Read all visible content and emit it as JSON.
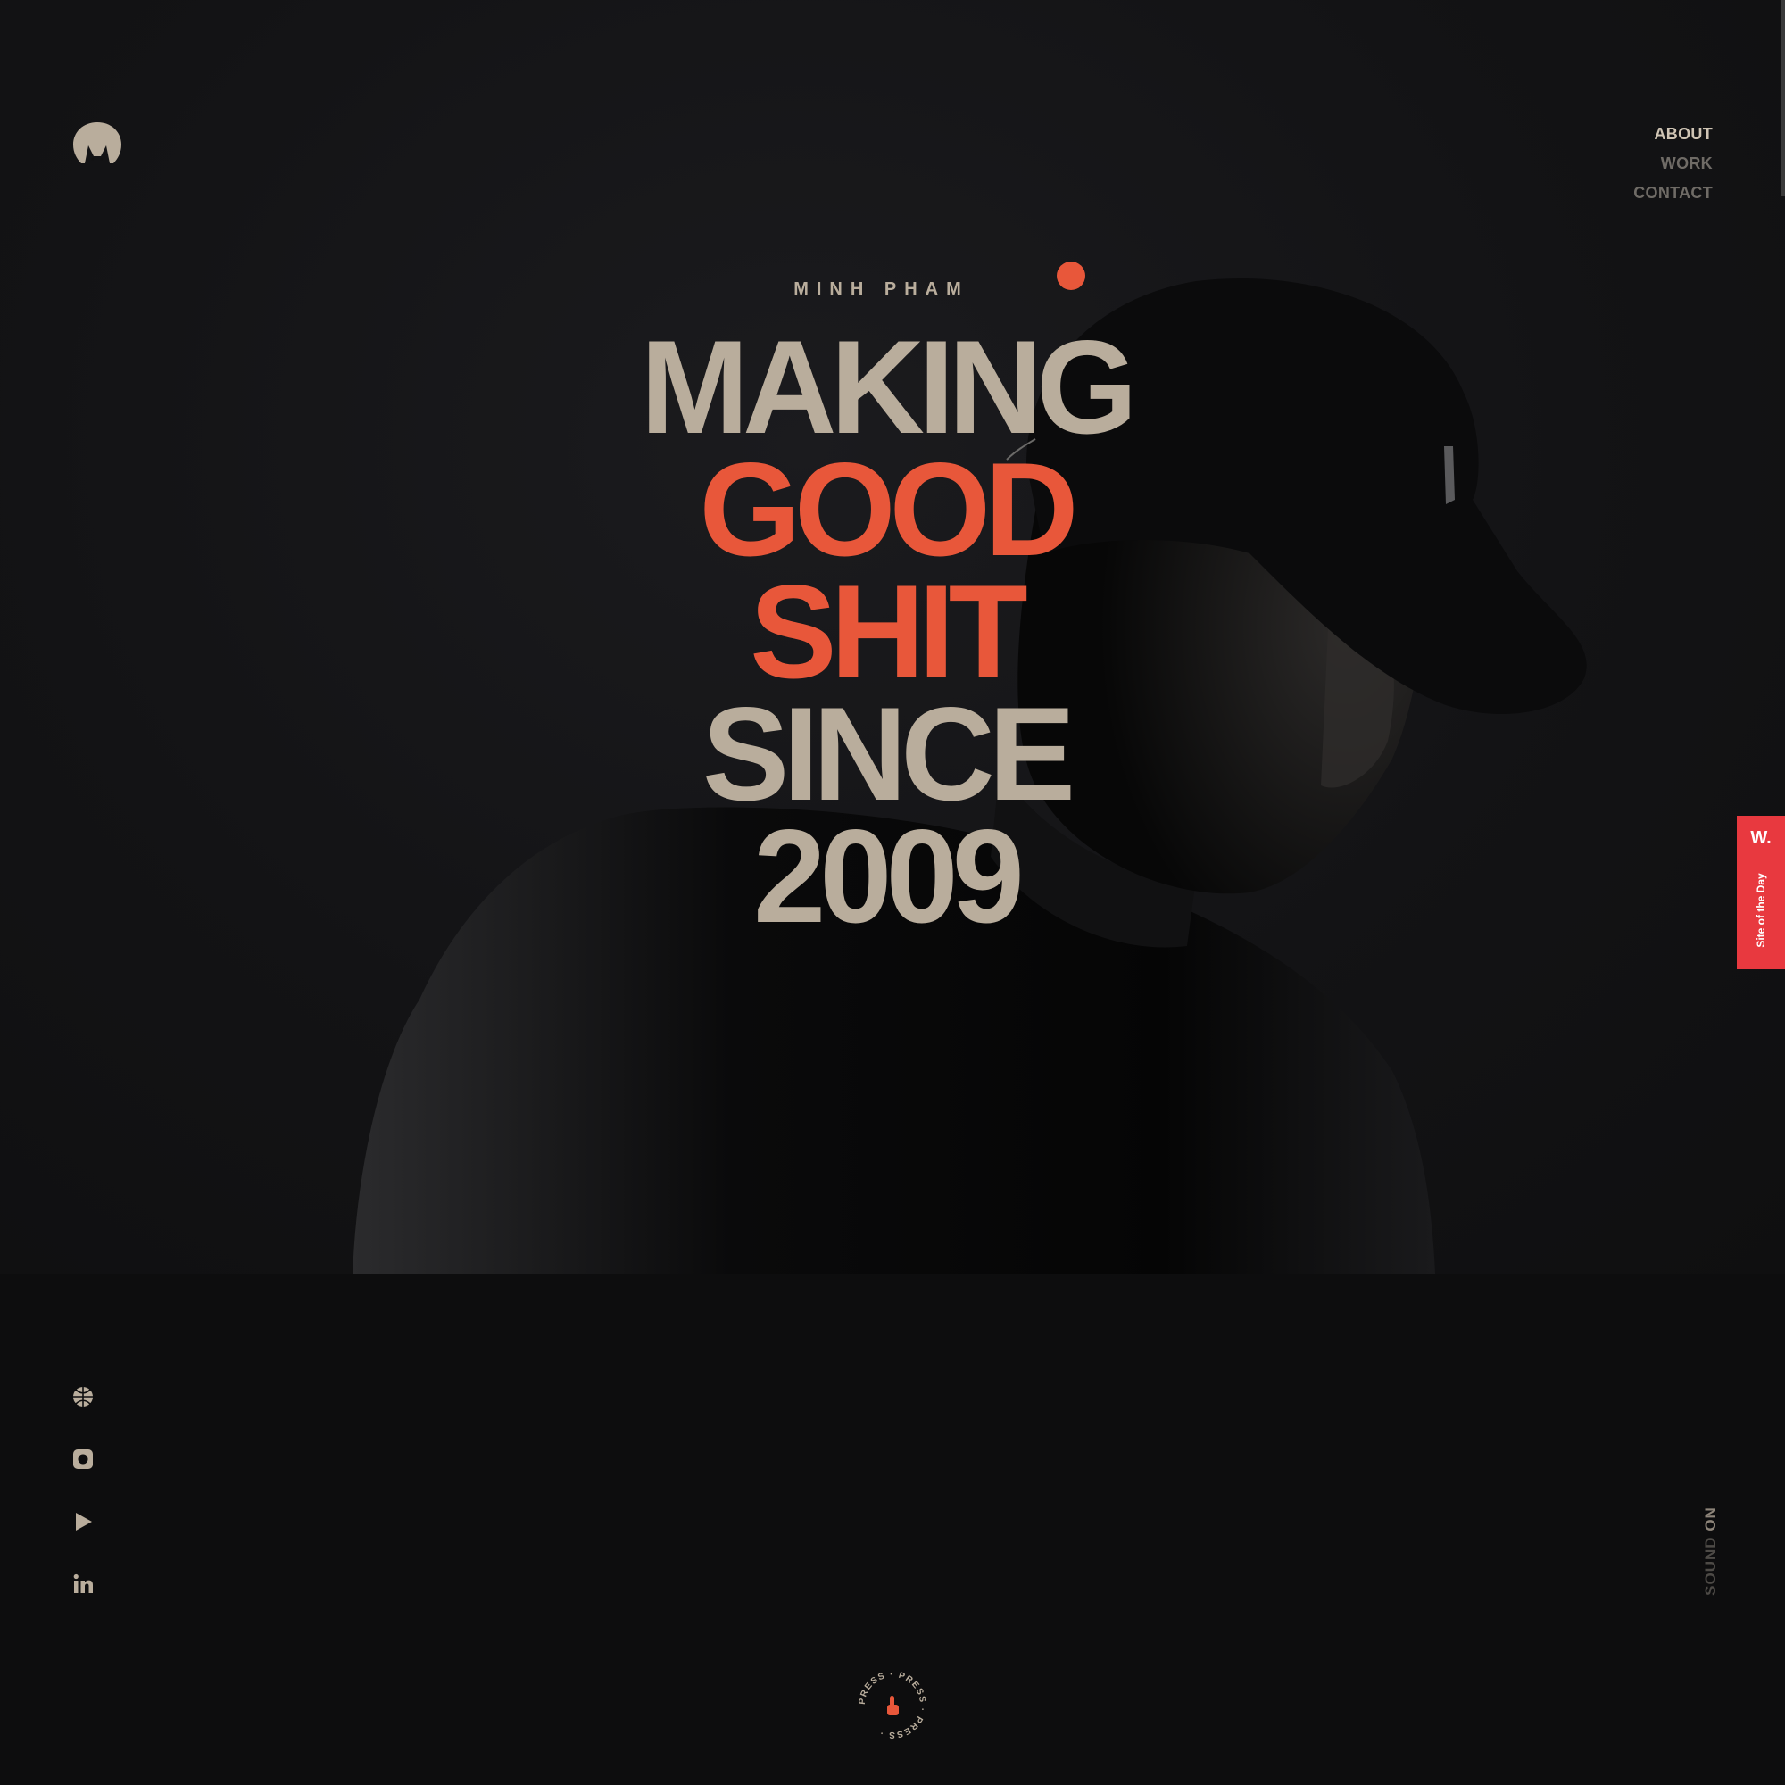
{
  "nav": {
    "items": [
      {
        "label": "ABOUT",
        "active": true
      },
      {
        "label": "WORK",
        "active": false
      },
      {
        "label": "CONTACT",
        "active": false
      }
    ]
  },
  "hero": {
    "eyebrow": "MINH PHAM",
    "lines": [
      "MAKING",
      "GOOD",
      "SHIT",
      "SINCE",
      "2009"
    ],
    "accent_lines": [
      1,
      2
    ]
  },
  "badge": {
    "mark": "W.",
    "label": "Site of the Day"
  },
  "social": {
    "icons": [
      "dribbble-icon",
      "instagram-icon",
      "youtube-icon",
      "linkedin-icon"
    ]
  },
  "sound": {
    "label": "SOUND",
    "state": "ON"
  },
  "press": {
    "text": "PRESS · PRESS · PRESS ·",
    "icon": "pointer-hand-icon"
  },
  "colors": {
    "background": "#0d0d0e",
    "accent": "#e8573a",
    "text": "#b9ad9c",
    "badge": "#e8393f"
  }
}
